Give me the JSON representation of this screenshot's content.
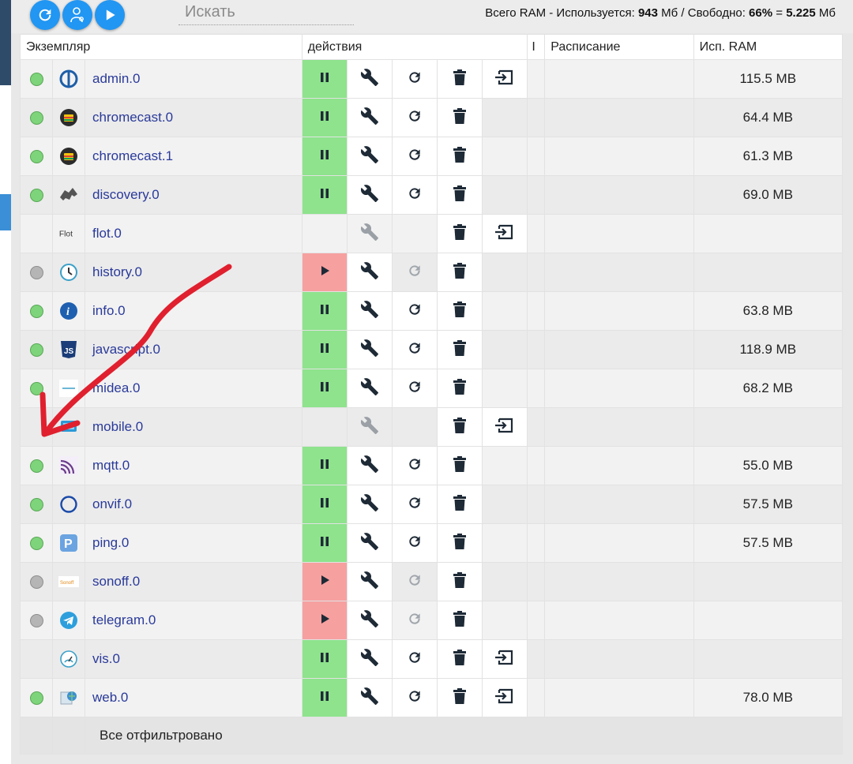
{
  "toolbar": {
    "buttons": [
      {
        "name": "refresh-button",
        "icon": "refresh-icon"
      },
      {
        "name": "expert-mode-button",
        "icon": "person-gear-icon"
      },
      {
        "name": "run-all-button",
        "icon": "play-icon"
      }
    ],
    "search_placeholder": "Искать"
  },
  "ram": {
    "prefix": "Всего RAM - Используется: ",
    "used": "943",
    "mid": " Мб / Свободно: ",
    "free_pct": "66%",
    "eq": " = ",
    "free": "5.225",
    "unit": " Мб"
  },
  "table": {
    "headers": {
      "instance": "Экземпляр",
      "actions": "действия",
      "hidden": "I",
      "schedule": "Расписание",
      "ram": "Исп. RAM"
    },
    "rows": [
      {
        "name": "admin.0",
        "status": "green",
        "icon": "admin-icon",
        "mode": "running",
        "has_link": true,
        "ram": "115.5 MB"
      },
      {
        "name": "chromecast.0",
        "status": "green",
        "icon": "chromecast-icon",
        "mode": "running",
        "has_link": false,
        "ram": "64.4 MB"
      },
      {
        "name": "chromecast.1",
        "status": "green",
        "icon": "chromecast-icon",
        "mode": "running",
        "has_link": false,
        "ram": "61.3 MB"
      },
      {
        "name": "discovery.0",
        "status": "green",
        "icon": "discovery-icon",
        "mode": "running",
        "has_link": false,
        "ram": "69.0 MB"
      },
      {
        "name": "flot.0",
        "status": "none",
        "icon": "flot-icon",
        "mode": "none",
        "has_link": true,
        "ram": ""
      },
      {
        "name": "history.0",
        "status": "grey",
        "icon": "history-icon",
        "mode": "stopped",
        "has_link": false,
        "ram": ""
      },
      {
        "name": "info.0",
        "status": "green",
        "icon": "info-icon",
        "mode": "running",
        "has_link": false,
        "ram": "63.8 MB"
      },
      {
        "name": "javascript.0",
        "status": "green",
        "icon": "javascript-icon",
        "mode": "running",
        "has_link": false,
        "ram": "118.9 MB"
      },
      {
        "name": "midea.0",
        "status": "green",
        "icon": "midea-icon",
        "mode": "running",
        "has_link": false,
        "ram": "68.2 MB"
      },
      {
        "name": "mobile.0",
        "status": "none",
        "icon": "mobile-icon",
        "mode": "none",
        "has_link": true,
        "ram": ""
      },
      {
        "name": "mqtt.0",
        "status": "green",
        "icon": "mqtt-icon",
        "mode": "running",
        "has_link": false,
        "ram": "55.0 MB"
      },
      {
        "name": "onvif.0",
        "status": "green",
        "icon": "onvif-icon",
        "mode": "running",
        "has_link": false,
        "ram": "57.5 MB"
      },
      {
        "name": "ping.0",
        "status": "green",
        "icon": "ping-icon",
        "mode": "running",
        "has_link": false,
        "ram": "57.5 MB"
      },
      {
        "name": "sonoff.0",
        "status": "grey",
        "icon": "sonoff-icon",
        "mode": "stopped",
        "has_link": false,
        "ram": ""
      },
      {
        "name": "telegram.0",
        "status": "grey",
        "icon": "telegram-icon",
        "mode": "stopped",
        "has_link": false,
        "ram": ""
      },
      {
        "name": "vis.0",
        "status": "none",
        "icon": "vis-icon",
        "mode": "running",
        "has_link": true,
        "ram": ""
      },
      {
        "name": "web.0",
        "status": "green",
        "icon": "web-icon",
        "mode": "running",
        "has_link": true,
        "ram": "78.0 MB"
      }
    ],
    "footer": "Все отфильтровано"
  },
  "icon_labels": {
    "flot": "Flot",
    "javascript": "JS",
    "ping": "P",
    "sonoff": "Sonoff"
  },
  "colors": {
    "running": "#8ee38c",
    "stopped": "#f7a0a0",
    "accent": "#2196f3",
    "link": "#2a3a9a",
    "annotation": "#e0202e"
  }
}
